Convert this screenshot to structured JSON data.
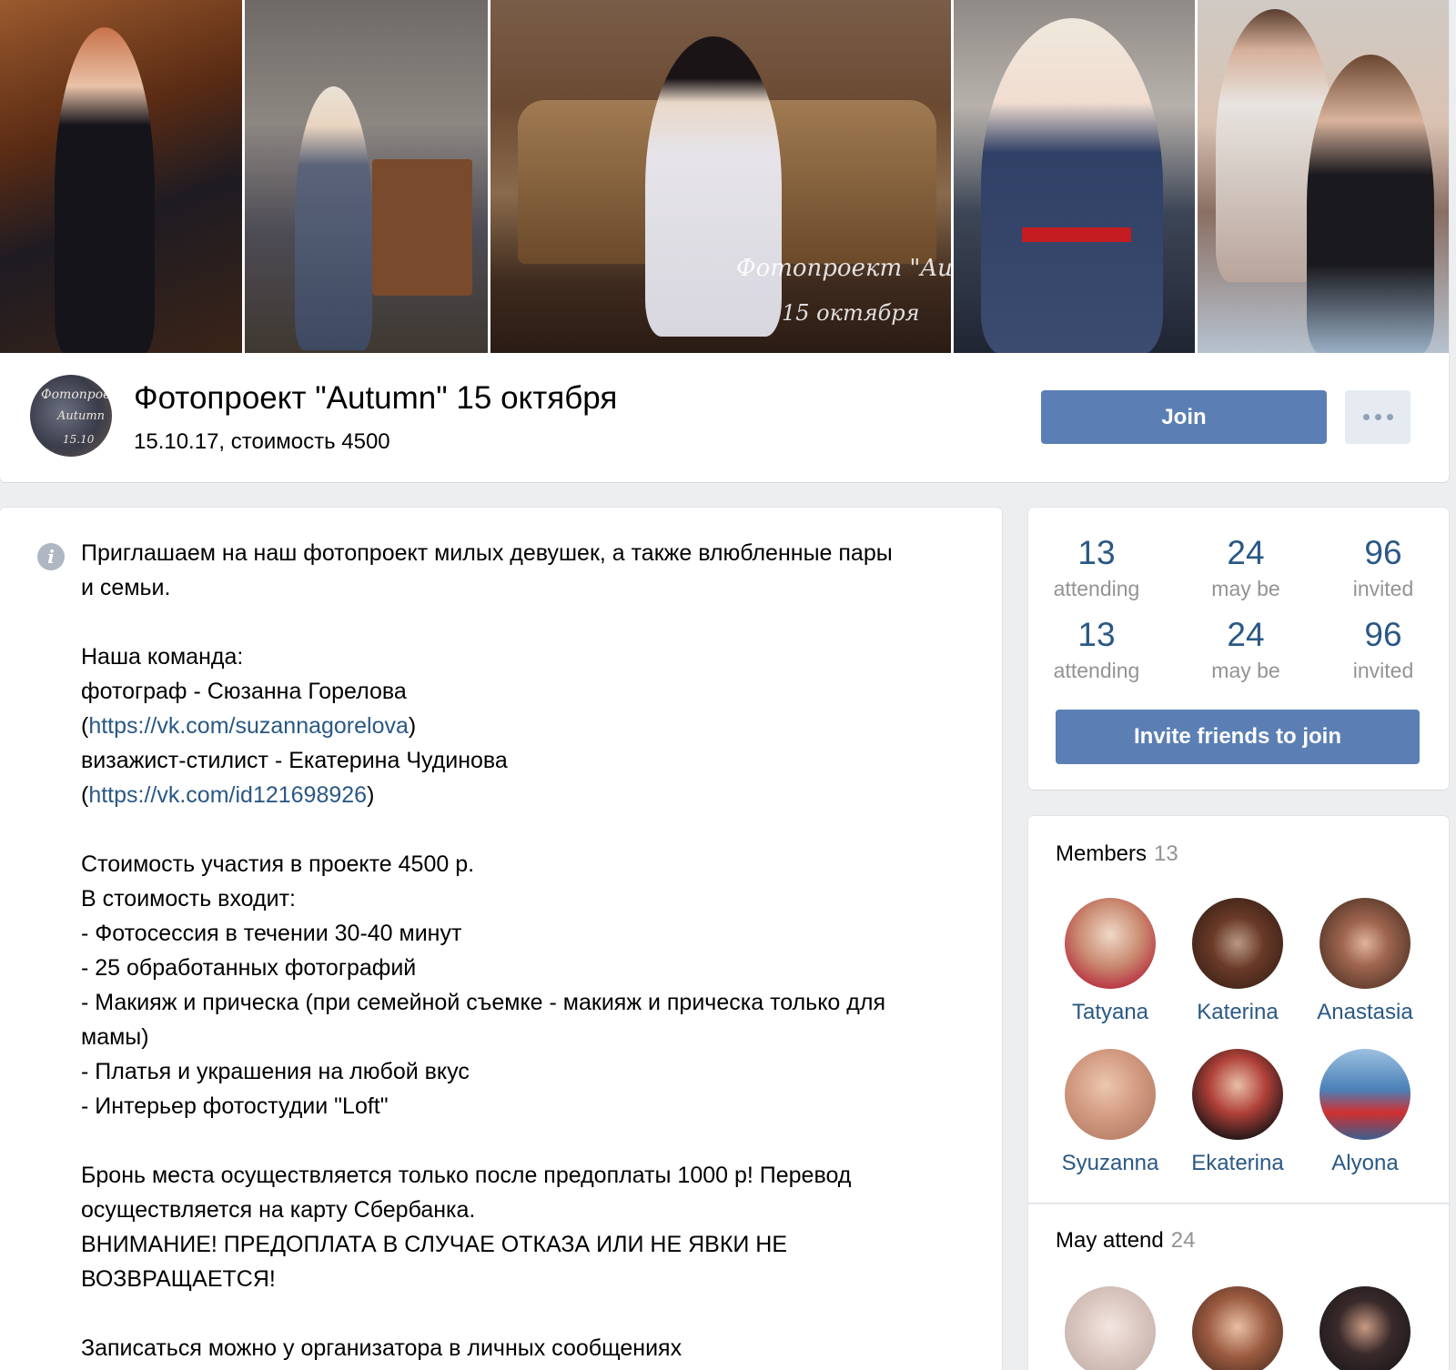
{
  "cover": {
    "watermark_line1": "Фотопроект \"Autumn\"",
    "watermark_line2": "15 октября"
  },
  "group": {
    "avatar_text_1": "Фотопроект",
    "avatar_text_2": "Autumn",
    "avatar_text_3": "15.10",
    "title": "Фотопроект \"Autumn\" 15 октября",
    "subtitle": "15.10.17, стоимость 4500",
    "join_label": "Join"
  },
  "description": {
    "lines": [
      "Приглашаем на наш фотопроект милых девушек, а также влюбленные пары",
      "и семьи.",
      "",
      "Наша команда:",
      "фотограф - Сюзанна Горелова",
      "",
      "визажист-стилист - Екатерина Чудинова",
      "",
      "",
      "Стоимость участия в проекте 4500 р.",
      "В стоимость входит:",
      "- Фотосессия в течении 30-40 минут",
      "- 25 обработанных фотографий",
      "- Макияж и прическа (при семейной съемке - макияж и прическа только для",
      "мамы)",
      "- Платья и украшения на любой вкус",
      "- Интерьер фотостудии \"Loft\"",
      "",
      "Бронь места осуществляется только после предоплаты 1000 р! Перевод",
      "осуществляется на карту Сбербанка.",
      "ВНИМАНИЕ! ПРЕДОПЛАТА В СЛУЧАЕ ОТКАЗА ИЛИ НЕ ЯВКИ НЕ",
      "ВОЗВРАЩАЕТСЯ!",
      "",
      "Записаться можно у организатора в личных сообщениях"
    ],
    "link1": "https://vk.com/suzannagorelova",
    "link2": "https://vk.com/id121698926",
    "paren_open": "(",
    "paren_close": ")"
  },
  "stats": {
    "row1": [
      {
        "num": "13",
        "label": "attending"
      },
      {
        "num": "24",
        "label": "may be"
      },
      {
        "num": "96",
        "label": "invited"
      }
    ],
    "row2": [
      {
        "num": "13",
        "label": "attending"
      },
      {
        "num": "24",
        "label": "may be"
      },
      {
        "num": "96",
        "label": "invited"
      }
    ],
    "invite_label": "Invite friends to join"
  },
  "members": {
    "title": "Members",
    "count": "13",
    "list": [
      {
        "name": "Tatyana",
        "color": "#c9a08a"
      },
      {
        "name": "Katerina",
        "color": "#4a2e24"
      },
      {
        "name": "Anastasia",
        "color": "#5a3a2c"
      },
      {
        "name": "Syuzanna",
        "color": "#d4a58c"
      },
      {
        "name": "Ekaterina",
        "color": "#8c2a26"
      },
      {
        "name": "Alyona",
        "color": "#5c86b6"
      }
    ]
  },
  "may_attend": {
    "title": "May attend",
    "count": "24"
  }
}
